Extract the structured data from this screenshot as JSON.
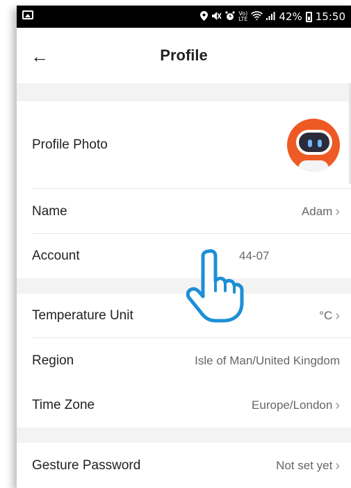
{
  "status_bar": {
    "battery": "42%",
    "time": "15:50",
    "volte_line1": "Vo)",
    "volte_line2": "LTE",
    "icons": [
      "gallery-icon",
      "location-icon",
      "mute-icon",
      "alarm-icon",
      "volte-icon",
      "wifi-icon",
      "signal-icon",
      "battery-icon"
    ]
  },
  "header": {
    "back": "←",
    "title": "Profile"
  },
  "rows": {
    "profile_photo": {
      "label": "Profile Photo"
    },
    "name": {
      "label": "Name",
      "value": "Adam"
    },
    "account": {
      "label": "Account",
      "value": "44-07"
    },
    "temperature": {
      "label": "Temperature Unit",
      "value": "°C"
    },
    "region": {
      "label": "Region",
      "value": "Isle of Man/United Kingdom"
    },
    "timezone": {
      "label": "Time Zone",
      "value": "Europe/London"
    },
    "gesture": {
      "label": "Gesture Password",
      "value": "Not set yet"
    }
  },
  "chevron": "›",
  "colors": {
    "accent": "#ee5a24",
    "hand_outline": "#1e8fd6",
    "section_gap": "#f3f3f3"
  }
}
